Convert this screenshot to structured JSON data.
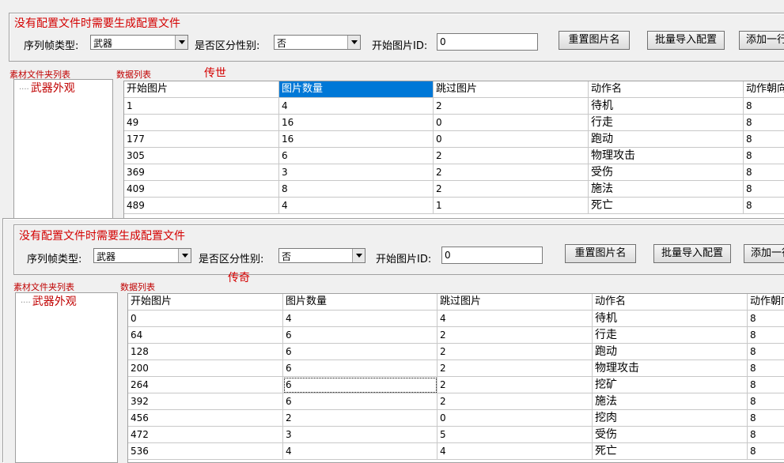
{
  "top": {
    "hint": "没有配置文件时需要生成配置文件",
    "seq_type_label": "序列帧类型:",
    "seq_type_value": "武器",
    "gender_label": "是否区分性别:",
    "gender_value": "否",
    "start_id_label": "开始图片ID:",
    "start_id_value": "0",
    "btn_reset": "重置图片名",
    "btn_import": "批量导入配置",
    "btn_add": "添加一行",
    "folder_label": "素材文件夹列表",
    "data_label": "数据列表",
    "game_tag": "传世",
    "tree_item": "武器外观",
    "columns": [
      "开始图片",
      "图片数量",
      "跳过图片",
      "动作名",
      "动作朝向"
    ],
    "rows": [
      [
        "1",
        "4",
        "2",
        "待机",
        "8"
      ],
      [
        "49",
        "16",
        "0",
        "行走",
        "8"
      ],
      [
        "177",
        "16",
        "0",
        "跑动",
        "8"
      ],
      [
        "305",
        "6",
        "2",
        "物理攻击",
        "8"
      ],
      [
        "369",
        "3",
        "2",
        "受伤",
        "8"
      ],
      [
        "409",
        "8",
        "2",
        "施法",
        "8"
      ],
      [
        "489",
        "4",
        "1",
        "死亡",
        "8"
      ]
    ]
  },
  "bottom": {
    "hint": "没有配置文件时需要生成配置文件",
    "seq_type_label": "序列帧类型:",
    "seq_type_value": "武器",
    "gender_label": "是否区分性别:",
    "gender_value": "否",
    "start_id_label": "开始图片ID:",
    "start_id_value": "0",
    "btn_reset": "重置图片名",
    "btn_import": "批量导入配置",
    "btn_add": "添加一行",
    "folder_label": "素材文件夹列表",
    "data_label": "数据列表",
    "game_tag": "传奇",
    "tree_item": "武器外观",
    "columns": [
      "开始图片",
      "图片数量",
      "跳过图片",
      "动作名",
      "动作朝向"
    ],
    "rows": [
      [
        "0",
        "4",
        "4",
        "待机",
        "8"
      ],
      [
        "64",
        "6",
        "2",
        "行走",
        "8"
      ],
      [
        "128",
        "6",
        "2",
        "跑动",
        "8"
      ],
      [
        "200",
        "6",
        "2",
        "物理攻击",
        "8"
      ],
      [
        "264",
        "6",
        "2",
        "挖矿",
        "8"
      ],
      [
        "392",
        "6",
        "2",
        "施法",
        "8"
      ],
      [
        "456",
        "2",
        "0",
        "挖肉",
        "8"
      ],
      [
        "472",
        "3",
        "5",
        "受伤",
        "8"
      ],
      [
        "536",
        "4",
        "4",
        "死亡",
        "8"
      ]
    ]
  }
}
